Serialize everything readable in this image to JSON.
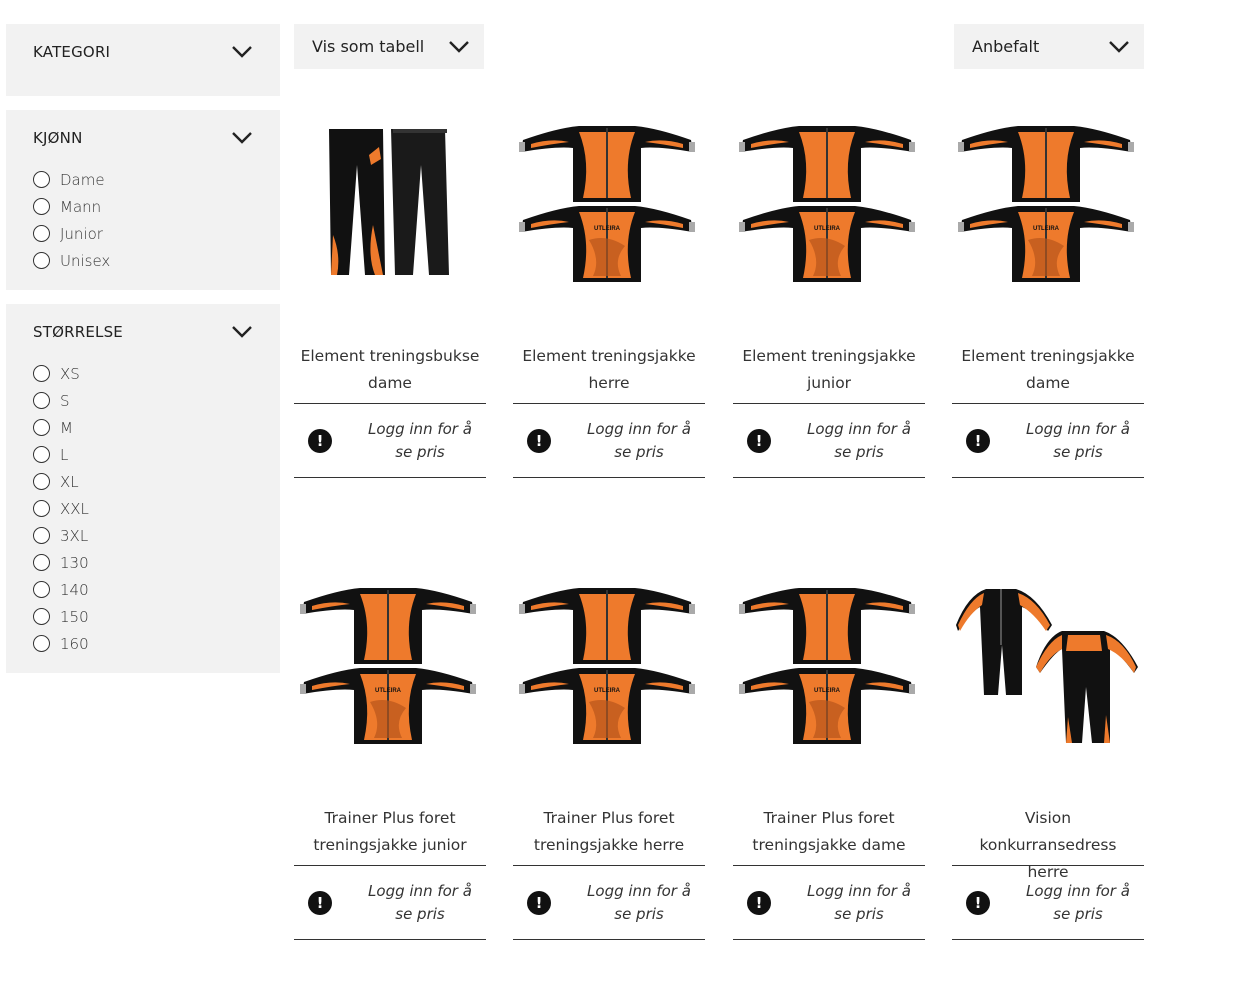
{
  "filters": {
    "kategori": {
      "title": "KATEGORI"
    },
    "kjonn": {
      "title": "KJØNN",
      "options": [
        "Dame",
        "Mann",
        "Junior",
        "Unisex"
      ]
    },
    "storrelse": {
      "title": "STØRRELSE",
      "options": [
        "XS",
        "S",
        "M",
        "L",
        "XL",
        "XXL",
        "3XL",
        "130",
        "140",
        "150",
        "160"
      ]
    }
  },
  "toolbar": {
    "view_label": "Vis som tabell",
    "sort_label": "Anbefalt"
  },
  "products": [
    {
      "name": "Element treningsbukse dame",
      "price_text": "Logg inn for å se pris",
      "image": "pants"
    },
    {
      "name": "Element treningsjakke herre",
      "price_text": "Logg inn for å se pris",
      "image": "jacket"
    },
    {
      "name": "Element treningsjakke junior",
      "price_text": "Logg inn for å se pris",
      "image": "jacket"
    },
    {
      "name": "Element treningsjakke dame",
      "price_text": "Logg inn for å se pris",
      "image": "jacket"
    },
    {
      "name": "Trainer Plus foret treningsjakke junior",
      "price_text": "Logg inn for å se pris",
      "image": "jacket"
    },
    {
      "name": "Trainer Plus foret treningsjakke herre",
      "price_text": "Logg inn for å se pris",
      "image": "jacket"
    },
    {
      "name": "Trainer Plus foret treningsjakke dame",
      "price_text": "Logg inn for å se pris",
      "image": "jacket"
    },
    {
      "name": "Vision konkurransedress herre",
      "price_text": "Logg inn for å se pris",
      "image": "suit"
    }
  ],
  "product_image_text": "UTLEIRA",
  "colors": {
    "accent_orange": "#ee7a2c",
    "garment_black": "#111111",
    "panel_bg": "#f2f2f2"
  },
  "icons": {
    "dropdown": "chevron-down-icon",
    "price_notice": "exclamation-icon"
  }
}
